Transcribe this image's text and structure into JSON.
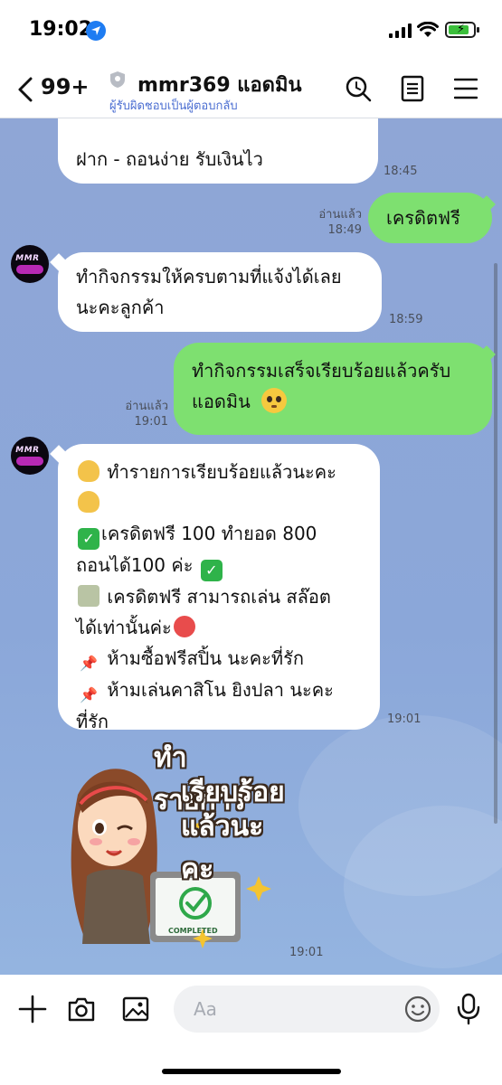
{
  "status": {
    "time": "19:02"
  },
  "header": {
    "unread_count": "99+",
    "chat_name": "mmr369 แอดมิน",
    "subtitle": "ผู้รับผิดชอบเป็นผู้ตอบกลับ"
  },
  "messages": {
    "m1": {
      "line": "ฝาก - ถอนง่าย รับเงินไว",
      "time": "18:45"
    },
    "m2": {
      "text": "เครดิตฟรี",
      "read": "อ่านแล้ว",
      "time": "18:49"
    },
    "m3": {
      "line1": "ทำกิจกรรมให้ครบตามที่แจ้งได้เลย",
      "line2": "นะคะลูกค้า",
      "time": "18:59"
    },
    "m4": {
      "line1": "ทำกิจกรรมเสร็จเรียบร้อยแล้วครับ",
      "line2": "แอดมิน",
      "read": "อ่านแล้ว",
      "time": "19:01"
    },
    "m5": {
      "line1": "ทำรายการเรียบร้อยแล้วนะคะ",
      "line3": "เครดิตฟรี 100 ทำยอด 800",
      "line4": "ถอนได้100 ค่ะ",
      "line5": "เครดิตฟรี สามารถเล่น สล๊อต",
      "line6": "ได้เท่านั้นค่ะ",
      "line7": "ห้ามซื้อฟรีสปิ้น นะคะที่รัก",
      "line8": "ห้ามเล่นคาสิโน  ยิงปลา นะคะ",
      "line9": "ที่รัก",
      "time": "19:01"
    },
    "sticker": {
      "line1": "ทำรายการ",
      "line2": "เรียบร้อย",
      "line3": "แล้วนะคะ",
      "badge": "COMPLETED",
      "time": "19:01"
    }
  },
  "avatar_text": "MMR",
  "input": {
    "placeholder": "Aa"
  },
  "colors": {
    "chat_bg": "#8fa6d6",
    "sent_bubble": "#7ee070",
    "received_bubble": "#ffffff",
    "link": "#4a6dd1"
  },
  "icons": [
    "back-icon",
    "shield-icon",
    "search-icon",
    "notes-icon",
    "menu-icon",
    "plus-icon",
    "camera-icon",
    "image-icon",
    "emoji-icon",
    "mic-icon"
  ]
}
